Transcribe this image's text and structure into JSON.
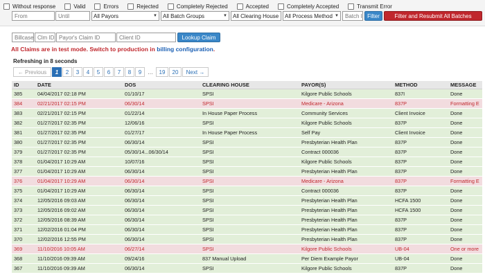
{
  "filters": {
    "checkboxes": [
      {
        "label": "Without response"
      },
      {
        "label": "Valid"
      },
      {
        "label": "Errors"
      },
      {
        "label": "Rejected"
      },
      {
        "label": "Completely Rejected"
      },
      {
        "label": "Accepted"
      },
      {
        "label": "Completely Accepted"
      },
      {
        "label": "Transmit Error"
      }
    ],
    "from_placeholder": "From",
    "until_placeholder": "Until",
    "payors_value": "All Payors",
    "batch_groups_value": "All Batch Groups",
    "clearing_house_value": "All Clearing House",
    "process_method_value": "All Process Method",
    "batch_id_placeholder": "Batch I",
    "filter_label": "Filter",
    "filter_resubmit_label": "Filter and Resubmit All Batches"
  },
  "lookup": {
    "billcase_placeholder": "Billcase",
    "clm_id_placeholder": "Clm ID",
    "payor_claim_placeholder": "Payor's Claim ID",
    "client_id_placeholder": "Client ID",
    "button_label": "Lookup Claim"
  },
  "notice": {
    "text": "All Claims are in test mode. Switch to production in",
    "link": "billing configuration",
    "end": "."
  },
  "refresh_text": "Refreshing in 8 seconds",
  "pagination": {
    "prev": "← Previous",
    "pages": [
      "1",
      "2",
      "3",
      "4",
      "5",
      "6",
      "7",
      "8",
      "9"
    ],
    "gap": "…",
    "tail": [
      "19",
      "20"
    ],
    "next": "Next →",
    "current": "1"
  },
  "colors": {
    "ok_row": "#e2efd9",
    "error_row": "#f2dcdf",
    "accent": "#3a87c8",
    "danger": "#c0272d"
  },
  "table": {
    "headers": [
      "ID",
      "DATE",
      "DOS",
      "CLEARING HOUSE",
      "PAYOR(S)",
      "METHOD",
      "MESSAGE"
    ],
    "rows": [
      {
        "status": "ok",
        "cells": [
          "385",
          "04/04/2017 02:18 PM",
          "01/10/17",
          "SPSI",
          "Kilgore Public Schools",
          "837I",
          "Done"
        ]
      },
      {
        "status": "err",
        "cells": [
          "384",
          "02/21/2017 02:15 PM",
          "06/30/14",
          "SPSI",
          "Medicare - Arizona",
          "837P",
          "Formatting E"
        ]
      },
      {
        "status": "ok",
        "cells": [
          "383",
          "02/21/2017 02:15 PM",
          "01/22/14",
          "In House Paper Process",
          "Community Services",
          "Client Invoice",
          "Done"
        ]
      },
      {
        "status": "ok",
        "cells": [
          "382",
          "01/27/2017 02:35 PM",
          "12/06/16",
          "SPSI",
          "Kilgore Public Schools",
          "837P",
          "Done"
        ]
      },
      {
        "status": "ok",
        "cells": [
          "381",
          "01/27/2017 02:35 PM",
          "01/27/17",
          "In House Paper Process",
          "Self Pay",
          "Client Invoice",
          "Done"
        ]
      },
      {
        "status": "ok",
        "cells": [
          "380",
          "01/27/2017 02:35 PM",
          "06/30/14",
          "SPSI",
          "Presbyterian Health Plan",
          "837P",
          "Done"
        ]
      },
      {
        "status": "ok",
        "cells": [
          "379",
          "01/27/2017 02:35 PM",
          "05/30/14...06/30/14",
          "SPSI",
          "Contract 000036",
          "837P",
          "Done"
        ]
      },
      {
        "status": "ok",
        "cells": [
          "378",
          "01/04/2017 10:29 AM",
          "10/07/16",
          "SPSI",
          "Kilgore Public Schools",
          "837P",
          "Done"
        ]
      },
      {
        "status": "ok",
        "cells": [
          "377",
          "01/04/2017 10:29 AM",
          "06/30/14",
          "SPSI",
          "Presbyterian Health Plan",
          "837P",
          "Done"
        ]
      },
      {
        "status": "err",
        "cells": [
          "376",
          "01/04/2017 10:29 AM",
          "06/30/14",
          "SPSI",
          "Medicare - Arizona",
          "837P",
          "Formatting E"
        ]
      },
      {
        "status": "ok",
        "cells": [
          "375",
          "01/04/2017 10:29 AM",
          "06/30/14",
          "SPSI",
          "Contract 000036",
          "837P",
          "Done"
        ]
      },
      {
        "status": "ok",
        "cells": [
          "374",
          "12/05/2016 09:03 AM",
          "06/30/14",
          "SPSI",
          "Presbyterian Health Plan",
          "HCFA 1500",
          "Done"
        ]
      },
      {
        "status": "ok",
        "cells": [
          "373",
          "12/05/2016 09:02 AM",
          "06/30/14",
          "SPSI",
          "Presbyterian Health Plan",
          "HCFA 1500",
          "Done"
        ]
      },
      {
        "status": "ok",
        "cells": [
          "372",
          "12/05/2016 08:39 AM",
          "06/30/14",
          "SPSI",
          "Presbyterian Health Plan",
          "837P",
          "Done"
        ]
      },
      {
        "status": "ok",
        "cells": [
          "371",
          "12/02/2016 01:04 PM",
          "06/30/14",
          "SPSI",
          "Presbyterian Health Plan",
          "837P",
          "Done"
        ]
      },
      {
        "status": "ok",
        "cells": [
          "370",
          "12/02/2016 12:55 PM",
          "06/30/14",
          "SPSI",
          "Presbyterian Health Plan",
          "837P",
          "Done"
        ]
      },
      {
        "status": "err",
        "cells": [
          "369",
          "11/10/2016 10:05 AM",
          "06/27/14",
          "SPSI",
          "Kilgore Public Schools",
          "UB-04",
          "One or more"
        ]
      },
      {
        "status": "ok",
        "cells": [
          "368",
          "11/10/2016 09:39 AM",
          "09/24/16",
          "837 Manual Upload",
          "Per Diem Example Payor",
          "UB-04",
          "Done"
        ]
      },
      {
        "status": "ok",
        "cells": [
          "367",
          "11/10/2016 09:39 AM",
          "06/30/14",
          "SPSI",
          "Kilgore Public Schools",
          "837P",
          "Done"
        ]
      }
    ]
  }
}
